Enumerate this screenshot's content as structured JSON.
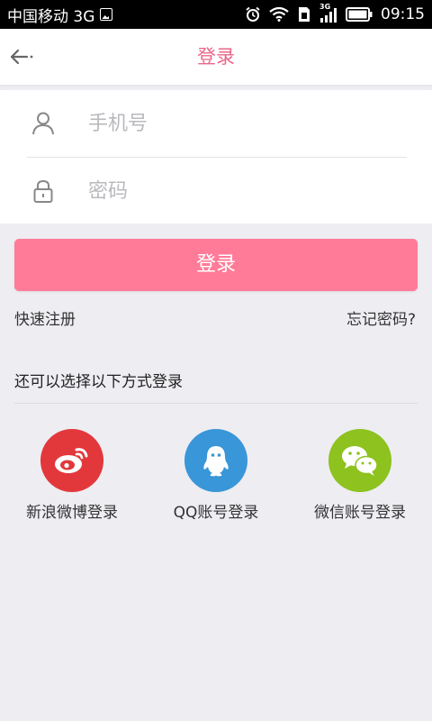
{
  "status_bar": {
    "carrier": "中国移动 3G",
    "time": "09:15",
    "network_tag": "3G"
  },
  "header": {
    "title": "登录"
  },
  "form": {
    "phone_placeholder": "手机号",
    "password_placeholder": "密码"
  },
  "actions": {
    "login_label": "登录",
    "register_label": "快速注册",
    "forgot_label": "忘记密码?"
  },
  "alt_login": {
    "title": "还可以选择以下方式登录",
    "options": [
      {
        "label": "新浪微博登录",
        "icon": "weibo-icon",
        "color": "#e2383c"
      },
      {
        "label": "QQ账号登录",
        "icon": "qq-icon",
        "color": "#3996d8"
      },
      {
        "label": "微信账号登录",
        "icon": "wechat-icon",
        "color": "#8dc21f"
      }
    ]
  },
  "colors": {
    "accent": "#e9678a",
    "button": "#ff7b98",
    "background": "#eeedf2"
  }
}
